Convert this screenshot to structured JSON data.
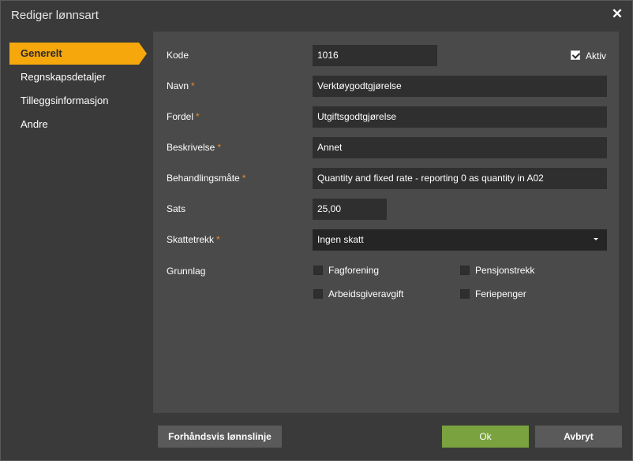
{
  "dialog": {
    "title": "Rediger lønnsart"
  },
  "sidebar": {
    "items": [
      {
        "label": "Generelt"
      },
      {
        "label": "Regnskapsdetaljer"
      },
      {
        "label": "Tilleggsinformasjon"
      },
      {
        "label": "Andre"
      }
    ]
  },
  "form": {
    "kode_label": "Kode",
    "kode_value": "1016",
    "aktiv_label": "Aktiv",
    "navn_label": "Navn",
    "navn_value": "Verktøygodtgjørelse",
    "fordel_label": "Fordel",
    "fordel_value": "Utgiftsgodtgjørelse",
    "beskrivelse_label": "Beskrivelse",
    "beskrivelse_value": "Annet",
    "behandlingsmate_label": "Behandlingsmåte",
    "behandlingsmate_value": "Quantity and fixed rate - reporting 0 as quantity in A02",
    "sats_label": "Sats",
    "sats_value": "25,00",
    "skattetrekk_label": "Skattetrekk",
    "skattetrekk_value": "Ingen skatt",
    "grunnlag_label": "Grunnlag",
    "required_mark": "*",
    "grunnlag": [
      {
        "label": "Fagforening"
      },
      {
        "label": "Pensjonstrekk"
      },
      {
        "label": "Arbeidsgiveravgift"
      },
      {
        "label": "Feriepenger"
      }
    ]
  },
  "buttons": {
    "preview_label": "Forhåndsvis lønnslinje",
    "ok_label": "Ok",
    "cancel_label": "Avbryt"
  },
  "colors": {
    "accent": "#f5a70c",
    "ok_button": "#7aa23f",
    "required": "#e88a2a"
  },
  "icons": {
    "close": "close-icon",
    "dropdown": "chevron-down-icon",
    "check": "checkmark-icon"
  }
}
